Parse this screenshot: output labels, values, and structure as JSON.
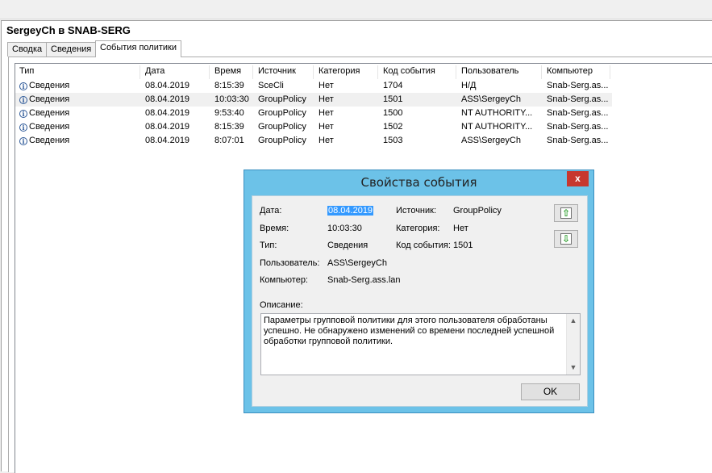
{
  "window": {
    "title": "SergeyCh в SNAB-SERG"
  },
  "tabs": [
    {
      "label": "Сводка"
    },
    {
      "label": "Сведения"
    },
    {
      "label": "События политики",
      "active": true
    }
  ],
  "table": {
    "columns": [
      "Тип",
      "Дата",
      "Время",
      "Источник",
      "Категория",
      "Код события",
      "Пользователь",
      "Компьютер"
    ],
    "rows": [
      [
        "Сведения",
        "08.04.2019",
        "8:15:39",
        "SceCli",
        "Нет",
        "1704",
        "Н/Д",
        "Snab-Serg.as..."
      ],
      [
        "Сведения",
        "08.04.2019",
        "10:03:30",
        "GroupPolicy",
        "Нет",
        "1501",
        "ASS\\SergeyCh",
        "Snab-Serg.as..."
      ],
      [
        "Сведения",
        "08.04.2019",
        "9:53:40",
        "GroupPolicy",
        "Нет",
        "1500",
        "NT AUTHORITY...",
        "Snab-Serg.as..."
      ],
      [
        "Сведения",
        "08.04.2019",
        "8:15:39",
        "GroupPolicy",
        "Нет",
        "1502",
        "NT AUTHORITY...",
        "Snab-Serg.as..."
      ],
      [
        "Сведения",
        "08.04.2019",
        "8:07:01",
        "GroupPolicy",
        "Нет",
        "1503",
        "ASS\\SergeyCh",
        "Snab-Serg.as..."
      ]
    ],
    "selected_row_index": 1
  },
  "dialog": {
    "title": "Свойства события",
    "close_glyph": "x",
    "labels": {
      "date": "Дата:",
      "time": "Время:",
      "type": "Тип:",
      "user": "Пользователь:",
      "computer": "Компьютер:",
      "source": "Источник:",
      "category": "Категория:",
      "event_id": "Код события:",
      "description": "Описание:"
    },
    "values": {
      "date": "08.04.2019",
      "time": "10:03:30",
      "type": "Сведения",
      "user": "ASS\\SergeyCh",
      "computer": "Snab-Serg.ass.lan",
      "source": "GroupPolicy",
      "category": "Нет",
      "event_id": "1501"
    },
    "description": "Параметры групповой политики для этого пользователя обработаны успешно. Не обнаружено изменений со времени последней успешной обработки групповой политики.",
    "ok_label": "OK",
    "icons": {
      "prev": "arrow-up-icon",
      "next": "arrow-down-icon"
    },
    "accent_color": "#6cc2e8"
  }
}
